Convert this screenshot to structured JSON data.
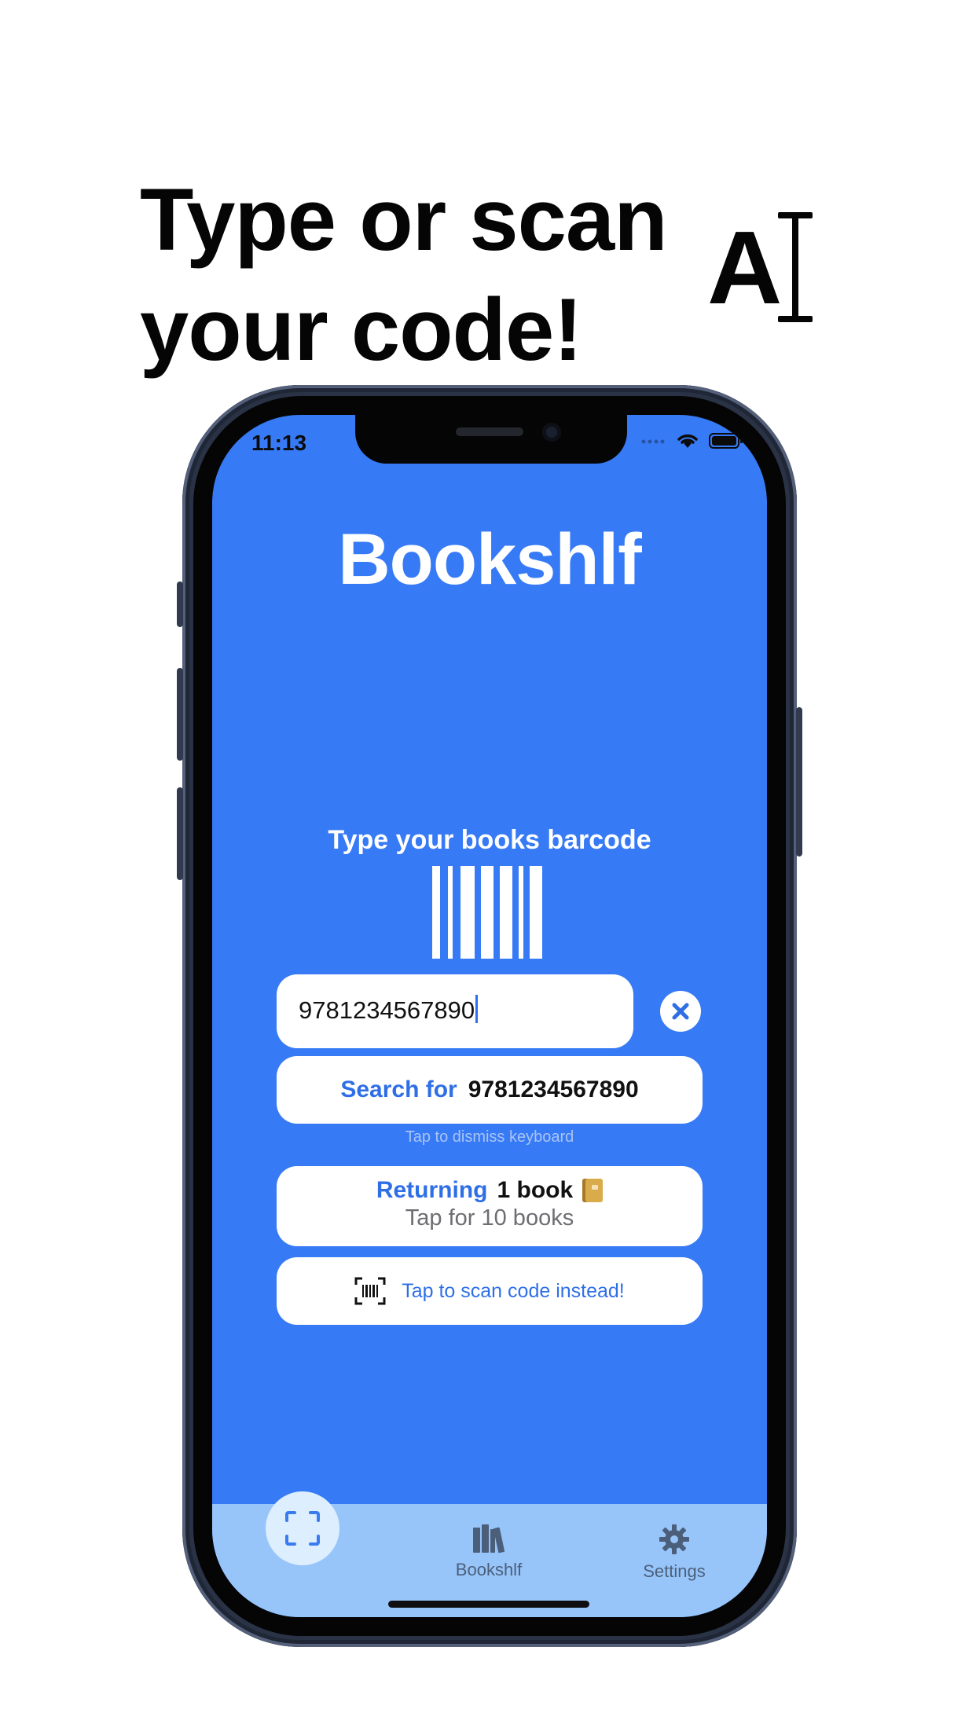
{
  "headline": {
    "line1": "Type or scan",
    "line2": "your code!"
  },
  "status_bar": {
    "time": "11:13"
  },
  "app": {
    "title": "Bookshlf",
    "prompt": "Type your books barcode",
    "input": {
      "value": "9781234567890"
    },
    "search_button": {
      "label": "Search for",
      "query": "9781234567890"
    },
    "dismiss_hint": "Tap to dismiss keyboard",
    "returning_button": {
      "label": "Returning",
      "count": "1 book",
      "subtitle": "Tap for 10 books"
    },
    "scan_button": {
      "label": "Tap to scan code instead!"
    }
  },
  "tabbar": {
    "items": [
      {
        "label": "Bookshlf",
        "icon": "books-icon"
      },
      {
        "label": "Settings",
        "icon": "gear-icon"
      }
    ],
    "scan_icon": "scan-frame-icon"
  },
  "colors": {
    "screen_bg": "#377af6",
    "tabbar_bg": "#97c5fa",
    "accent_blue": "#2f6fe6"
  }
}
